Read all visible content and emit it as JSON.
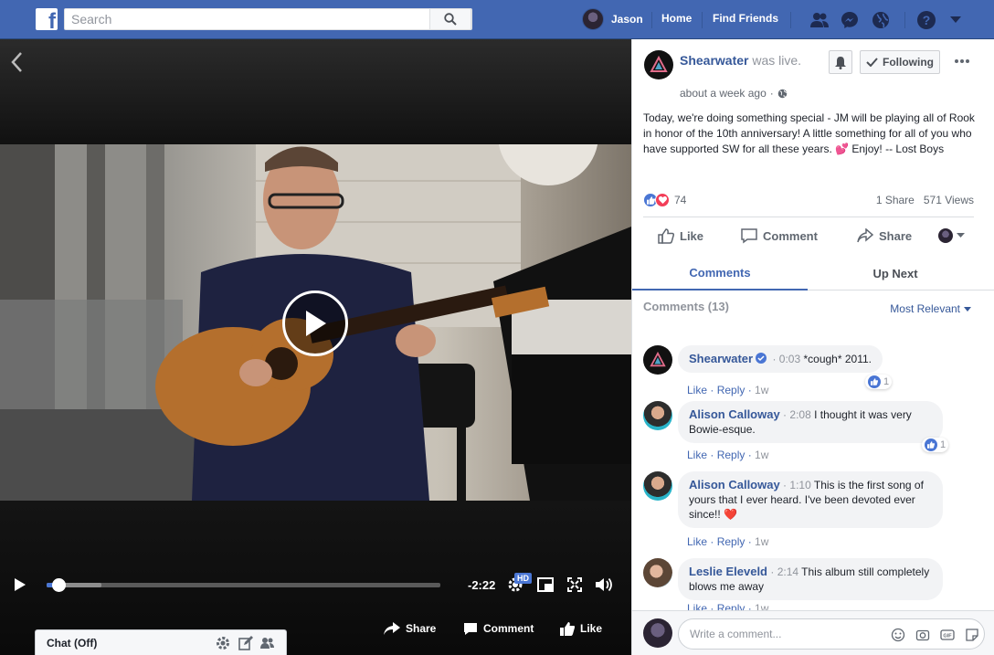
{
  "topbar": {
    "logo": "f",
    "search_placeholder": "Search",
    "user_name": "Jason",
    "nav_home": "Home",
    "nav_find_friends": "Find Friends"
  },
  "video": {
    "time_remaining": "-2:22",
    "hd_label": "HD",
    "progress": 0.03,
    "buffered": 0.14,
    "share_label": "Share",
    "comment_label": "Comment",
    "like_label": "Like"
  },
  "chat": {
    "label": "Chat (Off)"
  },
  "post": {
    "page_name": "Shearwater",
    "was_live": "was live.",
    "time": "about a week ago",
    "following_label": "Following",
    "text": "Today, we're doing something special - JM will be playing all of Rook in honor of the 10th anniversary! A little something for all of you who have supported SW for all these years. 💕 Enjoy! -- Lost Boys",
    "reaction_count": "74",
    "shares": "1 Share",
    "views": "571 Views",
    "like_label": "Like",
    "comment_label": "Comment",
    "share_label": "Share"
  },
  "tabs": {
    "comments": "Comments",
    "up_next": "Up Next"
  },
  "comments_section": {
    "header": "Comments (13)",
    "sort": "Most Relevant",
    "items": [
      {
        "name": "Shearwater",
        "time": "0:03",
        "text": "*cough* 2011.",
        "like": "Like",
        "reply": "Reply",
        "age": "1w",
        "likes": "1"
      },
      {
        "name": "Alison Calloway",
        "time": "2:08",
        "text": "I thought it was very Bowie-esque.",
        "like": "Like",
        "reply": "Reply",
        "age": "1w",
        "likes": "1"
      },
      {
        "name": "Alison Calloway",
        "time": "1:10",
        "text": "This is the first song of yours that I ever heard. I've been devoted ever since!! ❤️",
        "like": "Like",
        "reply": "Reply",
        "age": "1w"
      },
      {
        "name": "Leslie Eleveld",
        "time": "2:14",
        "text": "This album still completely blows me away",
        "like": "Like",
        "reply": "Reply",
        "age": "1w"
      }
    ]
  },
  "composer": {
    "placeholder": "Write a comment..."
  },
  "colors": {
    "brand": "#4267b2",
    "link": "#365899",
    "like": "#4a76d4",
    "love": "#f33e58"
  }
}
